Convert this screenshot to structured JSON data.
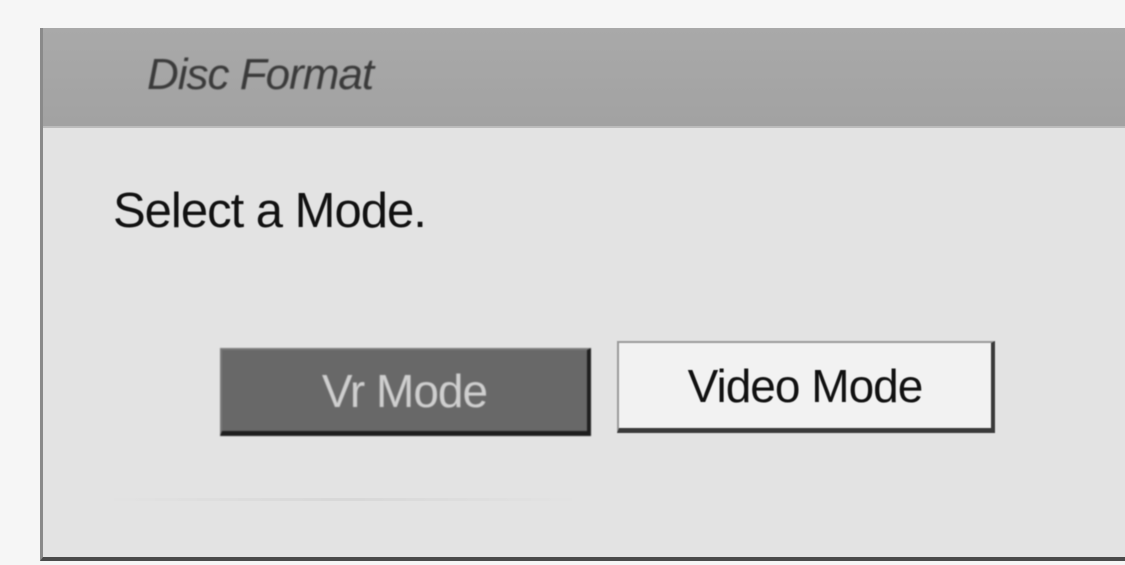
{
  "dialog": {
    "title": "Disc Format",
    "prompt": "Select a Mode.",
    "buttons": [
      {
        "label": "Vr Mode",
        "selected": true
      },
      {
        "label": "Video Mode",
        "selected": false
      }
    ]
  },
  "colors": {
    "title_bar": "#a6a6a6",
    "dialog_bg": "#e3e3e3",
    "selected_button_bg": "#686868",
    "selected_button_text": "#cfcfcf",
    "unselected_button_bg": "#f2f2f2",
    "unselected_button_text": "#111111"
  }
}
